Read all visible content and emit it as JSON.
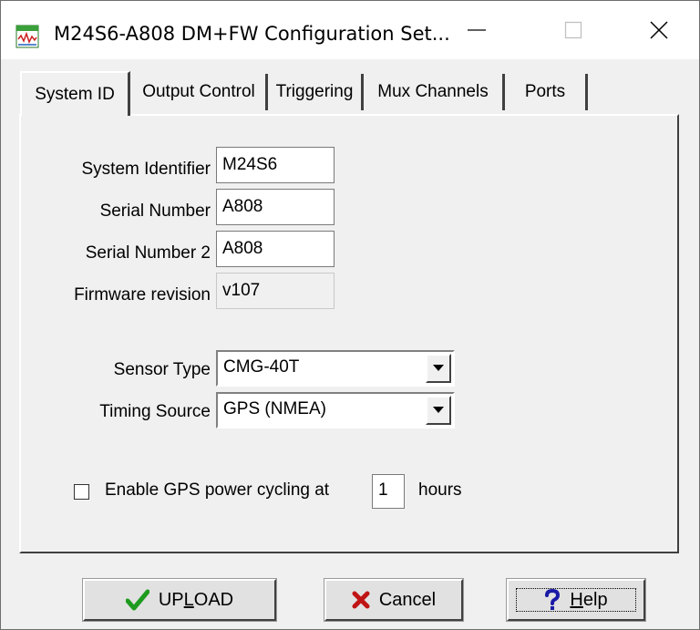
{
  "window": {
    "title": "M24S6-A808 DM+FW Configuration Set..."
  },
  "tabs": [
    {
      "label": "System ID",
      "active": true
    },
    {
      "label": "Output Control",
      "active": false
    },
    {
      "label": "Triggering",
      "active": false
    },
    {
      "label": "Mux Channels",
      "active": false
    },
    {
      "label": "Ports",
      "active": false
    }
  ],
  "system_id": {
    "system_identifier": {
      "label": "System Identifier",
      "value": "M24S6"
    },
    "serial_number": {
      "label": "Serial Number",
      "value": "A808"
    },
    "serial_number_2": {
      "label": "Serial Number 2",
      "value": "A808"
    },
    "firmware_revision": {
      "label": "Firmware revision",
      "value": "v107"
    },
    "sensor_type": {
      "label": "Sensor Type",
      "value": "CMG-40T"
    },
    "timing_source": {
      "label": "Timing Source",
      "value": "GPS (NMEA)"
    },
    "gps_power_cycling": {
      "checked": false,
      "label_before": "Enable GPS power cycling at",
      "hours_value": "1",
      "label_after": "hours"
    }
  },
  "buttons": {
    "upload": {
      "pre": "UP",
      "accel": "L",
      "post": "OAD",
      "icon": "checkmark-icon",
      "color": "#1e9b1e"
    },
    "cancel": {
      "label": "Cancel",
      "icon": "x-icon",
      "color": "#c01414"
    },
    "help": {
      "accel": "H",
      "post": "elp",
      "icon": "question-icon",
      "color": "#1a1aa6"
    }
  }
}
